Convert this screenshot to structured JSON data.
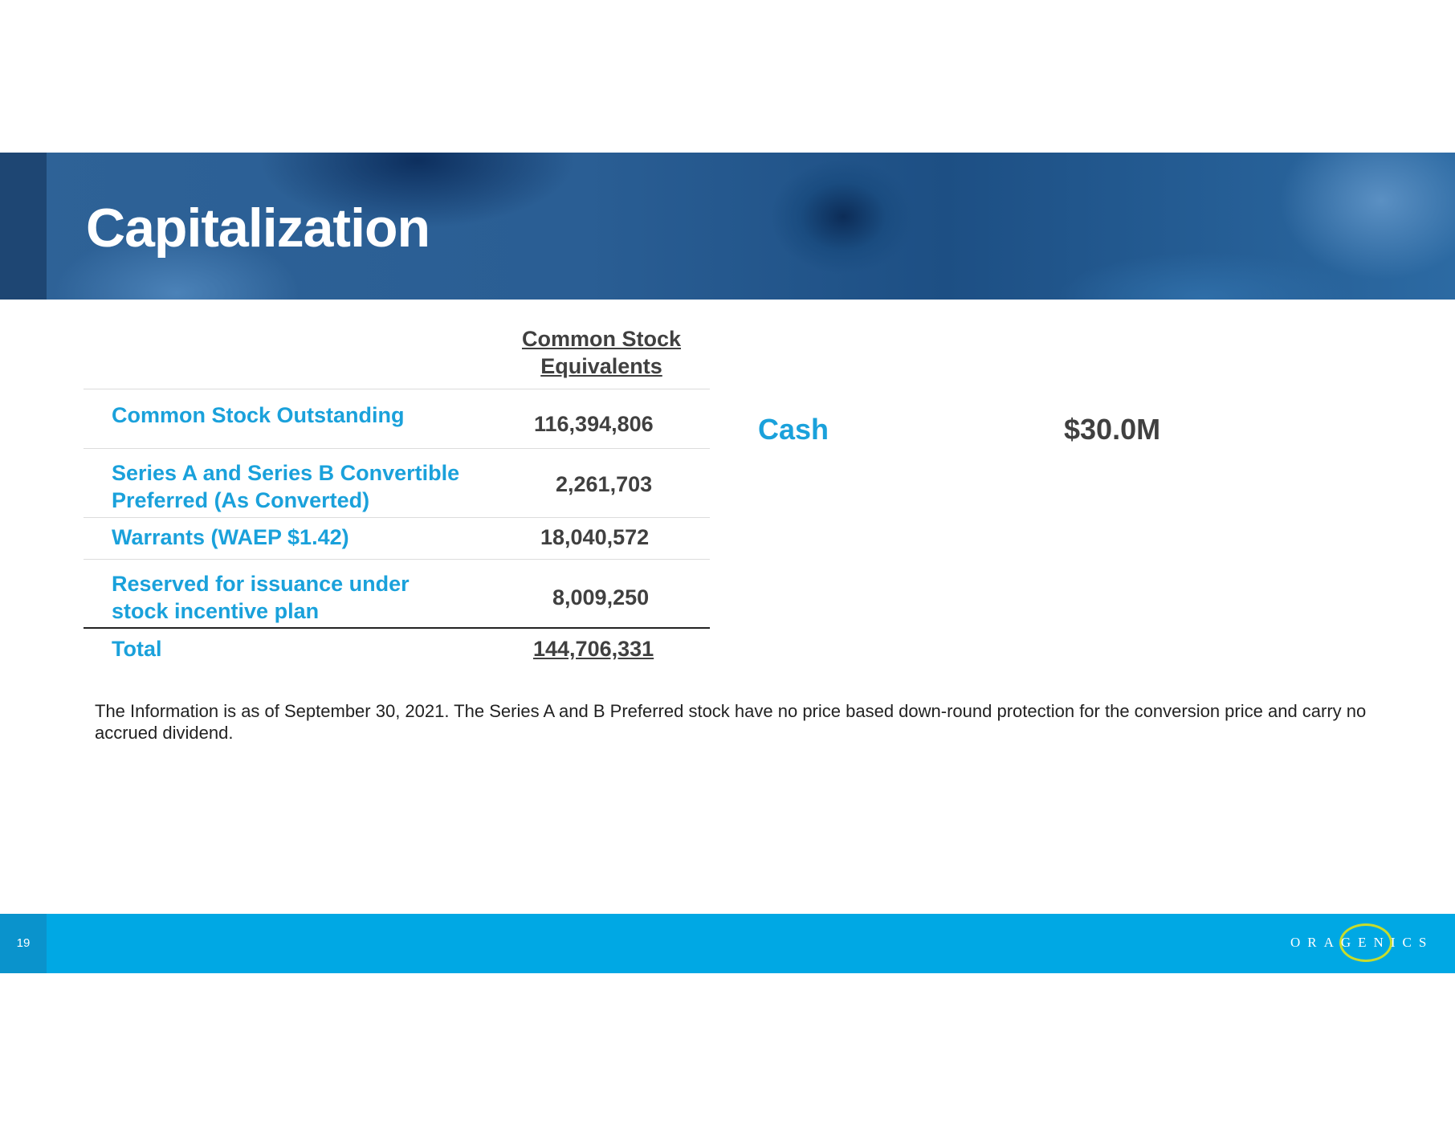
{
  "slide": {
    "title": "Capitalization",
    "page_number": "19"
  },
  "table": {
    "column_header": "Common Stock Equivalents",
    "rows": [
      {
        "label": "Common Stock Outstanding",
        "value": "116,394,806"
      },
      {
        "label": "Series A and Series B Convertible Preferred (As Converted)",
        "value": "2,261,703"
      },
      {
        "label": "Warrants (WAEP $1.42)",
        "value": "18,040,572"
      },
      {
        "label": "Reserved for issuance under stock incentive plan",
        "value": "8,009,250"
      }
    ],
    "total": {
      "label": "Total",
      "value": "144,706,331"
    }
  },
  "cash": {
    "label": "Cash",
    "value": "$30.0M"
  },
  "note": "The Information is as of September 30, 2021. The Series A and B Preferred stock have no price based down-round protection for the conversion price and carry no accrued dividend.",
  "footer": {
    "logo_text": "ORAGENICS"
  },
  "colors": {
    "accent_blue": "#1aa1db",
    "footer_blue": "#00a8e4",
    "banner_blue": "#2a5e94",
    "logo_ring": "#c7dc2c",
    "value_gray": "#404040"
  }
}
